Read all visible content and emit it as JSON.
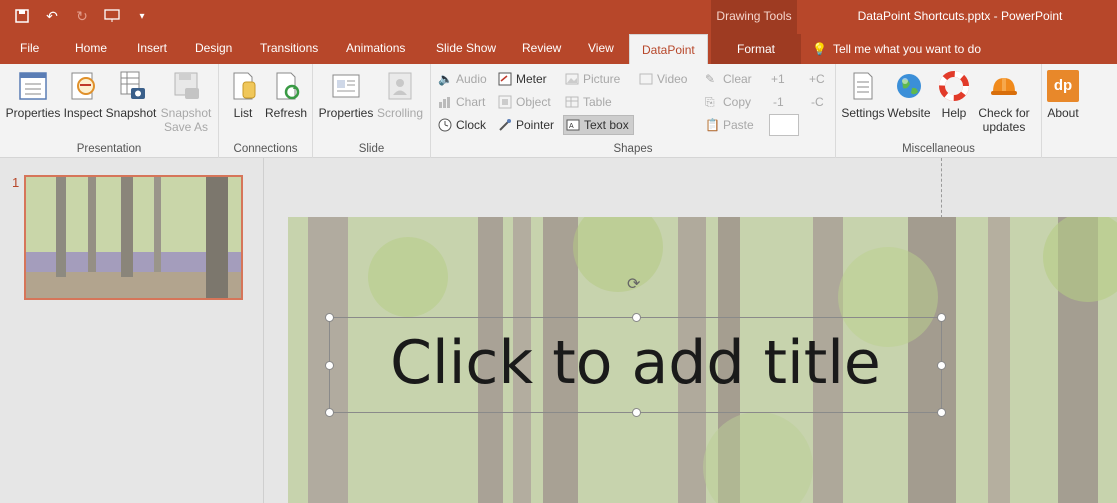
{
  "titlebar": {
    "contextual_group": "Drawing Tools",
    "document_title": "DataPoint Shortcuts.pptx - PowerPoint"
  },
  "tabs": [
    "File",
    "Home",
    "Insert",
    "Design",
    "Transitions",
    "Animations",
    "Slide Show",
    "Review",
    "View",
    "DataPoint",
    "Format"
  ],
  "tell_me": "Tell me what you want to do",
  "ribbon": {
    "presentation": {
      "label": "Presentation",
      "buttons": [
        "Properties",
        "Inspect",
        "Snapshot"
      ],
      "snapshot_save_as": [
        "Snapshot",
        "Save As"
      ]
    },
    "connections": {
      "label": "Connections",
      "buttons": [
        "List",
        "Refresh"
      ]
    },
    "slide": {
      "label": "Slide",
      "buttons": [
        "Properties",
        "Scrolling"
      ]
    },
    "shapes": {
      "label": "Shapes",
      "col1": [
        "Audio",
        "Chart",
        "Clock"
      ],
      "col2": [
        "Meter",
        "Object",
        "Pointer"
      ],
      "col3": [
        "Picture",
        "Table",
        "Text box"
      ],
      "col4": [
        "Video"
      ]
    },
    "clipboard": {
      "items": [
        "Clear",
        "Copy",
        "Paste"
      ],
      "nums": [
        "+1",
        "-1",
        "+C",
        "-C"
      ]
    },
    "misc": {
      "label": "Miscellaneous",
      "buttons": [
        "Settings",
        "Website",
        "Help"
      ],
      "check_updates": [
        "Check for",
        "updates"
      ],
      "about": "About",
      "about_logo": "dp"
    }
  },
  "thumbnails": {
    "slide_number": "1"
  },
  "slide": {
    "title_placeholder": "Click to add title"
  }
}
